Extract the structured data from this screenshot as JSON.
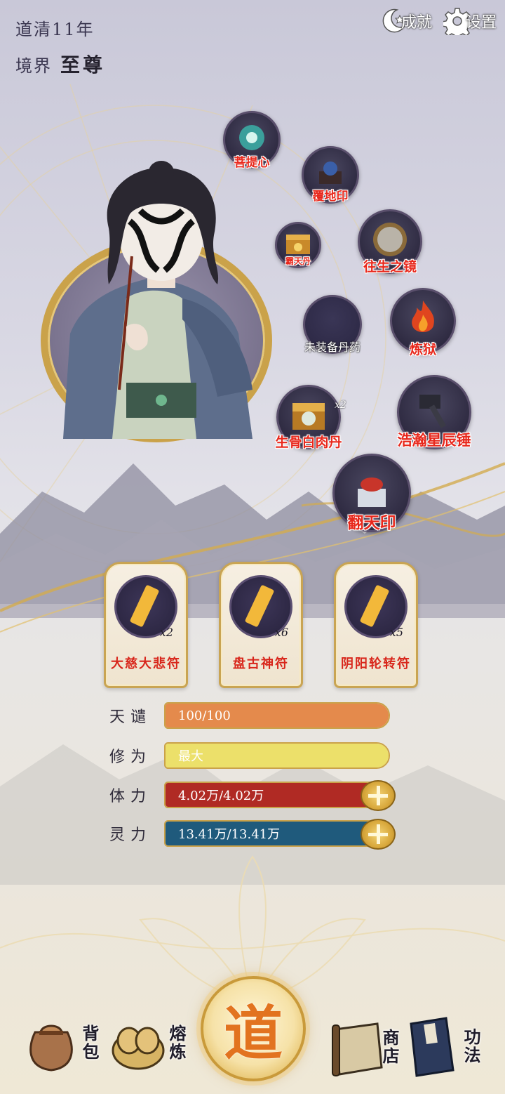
{
  "status": {
    "year": "道清11年",
    "realm_label": "境界",
    "realm_value": "至尊"
  },
  "top_buttons": {
    "achievements": "成就",
    "settings": "设置"
  },
  "equipment": [
    {
      "id": "puti",
      "label": "菩提心",
      "filled": true
    },
    {
      "id": "fudi",
      "label": "覆地印",
      "filled": true
    },
    {
      "id": "nidan",
      "label": "霸天丹",
      "filled": true
    },
    {
      "id": "wangsheng",
      "label": "往生之镜",
      "filled": true
    },
    {
      "id": "empty",
      "label": "未装备丹药",
      "filled": false
    },
    {
      "id": "lianyu",
      "label": "炼狱",
      "filled": true
    },
    {
      "id": "shenggu",
      "label": "生骨白肉丹",
      "filled": true,
      "count": "x2"
    },
    {
      "id": "haohan",
      "label": "浩瀚星辰锤",
      "filled": true
    },
    {
      "id": "fantian",
      "label": "翻天印",
      "filled": true
    }
  ],
  "talismans": [
    {
      "name": "大慈大悲符",
      "count": "x2"
    },
    {
      "name": "盘古神符",
      "count": "x6"
    },
    {
      "name": "阴阳轮转符",
      "count": "x5"
    }
  ],
  "stats": [
    {
      "label": "天谴",
      "value": "100/100",
      "fill": 1.0,
      "color": "#e48a4c",
      "text_color": "#ffffff",
      "plus": false
    },
    {
      "label": "修为",
      "value": "最大",
      "fill": 1.0,
      "color": "#ece06a",
      "text_color": "#ffffff",
      "plus": false
    },
    {
      "label": "体力",
      "value": "4.02万/4.02万",
      "fill": 1.0,
      "color": "#b02a24",
      "text_color": "#ffffff",
      "plus": true
    },
    {
      "label": "灵力",
      "value": "13.41万/13.41万",
      "fill": 1.0,
      "color": "#1f5a7c",
      "text_color": "#ffffff",
      "plus": true
    }
  ],
  "nav": {
    "bag": "背包",
    "smelt": "熔炼",
    "dao": "道",
    "shop": "商店",
    "skills": "功法"
  }
}
